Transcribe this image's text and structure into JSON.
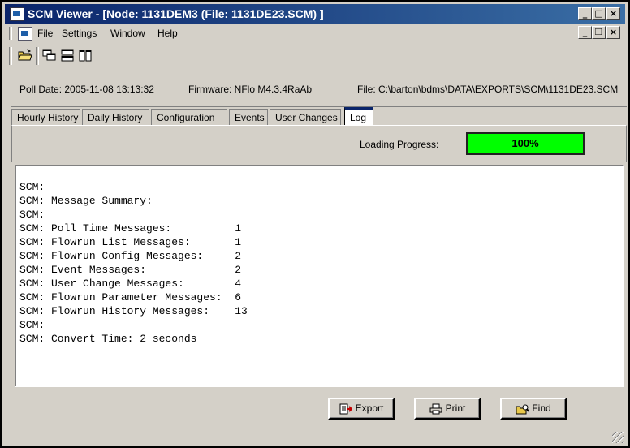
{
  "window": {
    "title": "SCM Viewer - [Node: 1131DEM3 (File: 1131DE23.SCM) ]"
  },
  "menu": {
    "items": [
      "File",
      "Settings",
      "Window",
      "Help"
    ]
  },
  "toolbar": {
    "icons": [
      "open-folder-icon",
      "cascade-icon",
      "tile-horizontal-icon",
      "tile-vertical-icon"
    ]
  },
  "info": {
    "poll_date": "Poll Date: 2005-11-08 13:13:32",
    "firmware": "Firmware: NFlo M4.3.4RaAb",
    "file": "File: C:\\barton\\bdms\\DATA\\EXPORTS\\SCM\\1131DE23.SCM"
  },
  "tabs": [
    {
      "label": "Hourly History",
      "active": false
    },
    {
      "label": "Daily History",
      "active": false
    },
    {
      "label": "Configuration",
      "active": false
    },
    {
      "label": "Events",
      "active": false
    },
    {
      "label": "User Changes",
      "active": false
    },
    {
      "label": "Log",
      "active": true
    }
  ],
  "progress": {
    "label": "Loading Progress:",
    "value_text": "100%",
    "value": 100,
    "color": "#00ff00"
  },
  "log": {
    "lines": [
      "SCM:",
      "SCM: Message Summary:",
      "SCM:",
      "SCM: Poll Time Messages:          1",
      "SCM: Flowrun List Messages:       1",
      "SCM: Flowrun Config Messages:     2",
      "SCM: Event Messages:              2",
      "SCM: User Change Messages:        4",
      "SCM: Flowrun Parameter Messages:  6",
      "SCM: Flowrun History Messages:    13",
      "SCM:",
      "SCM: Convert Time: 2 seconds"
    ]
  },
  "buttons": {
    "export": "Export",
    "print": "Print",
    "find": "Find"
  },
  "colors": {
    "title_start": "#0a246a",
    "title_end": "#3a6ea5",
    "face": "#d4d0c8"
  }
}
